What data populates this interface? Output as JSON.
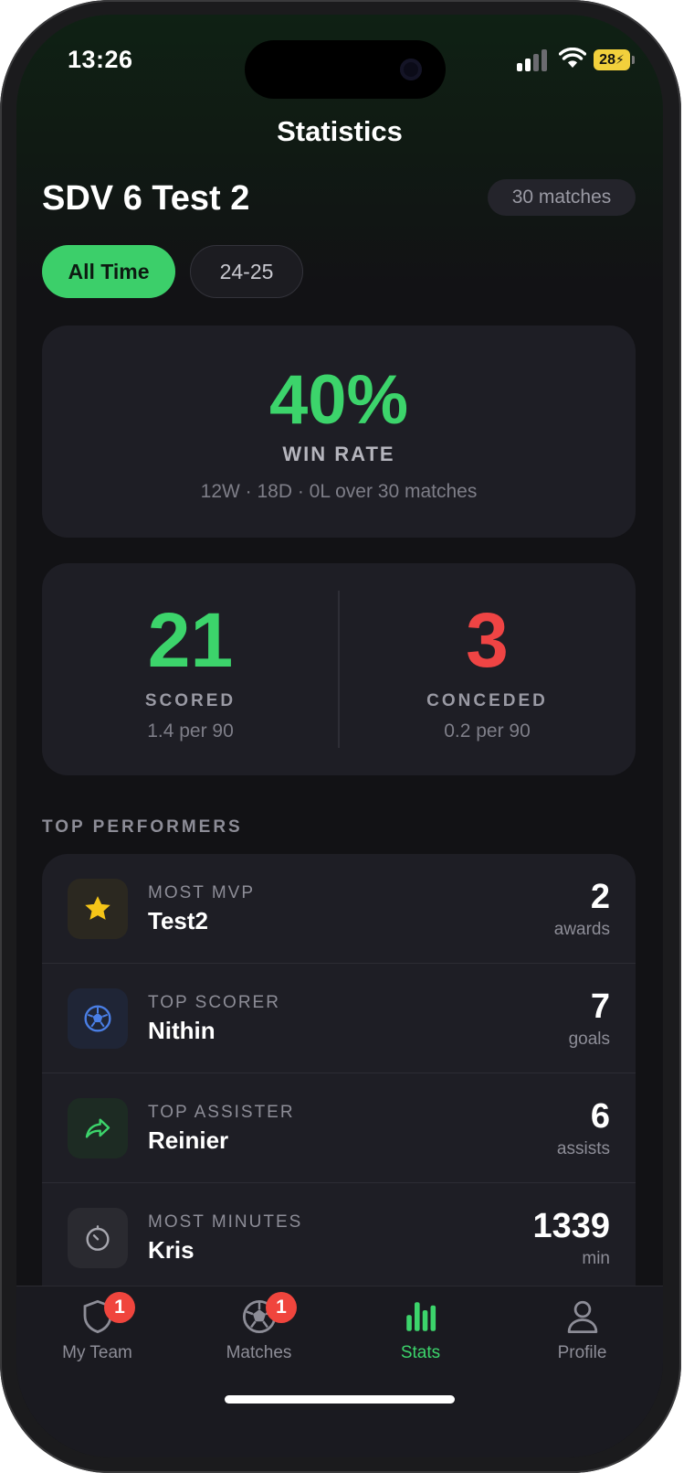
{
  "status_bar": {
    "time": "13:26",
    "battery": "28"
  },
  "nav": {
    "title": "Statistics"
  },
  "team": {
    "name": "SDV 6 Test 2",
    "matches_badge": "30 matches"
  },
  "filters": [
    {
      "label": "All Time",
      "selected": true
    },
    {
      "label": "24-25",
      "selected": false
    }
  ],
  "win_rate": {
    "value": "40%",
    "label": "WIN RATE",
    "detail": "12W · 18D · 0L over 30 matches"
  },
  "goals": {
    "scored": {
      "value": "21",
      "label": "SCORED",
      "rate": "1.4 per 90"
    },
    "conceded": {
      "value": "3",
      "label": "CONCEDED",
      "rate": "0.2 per 90"
    }
  },
  "top_performers": {
    "heading": "TOP PERFORMERS",
    "items": [
      {
        "category": "MOST MVP",
        "name": "Test2",
        "value": "2",
        "unit": "awards",
        "icon": "star-icon"
      },
      {
        "category": "TOP SCORER",
        "name": "Nithin",
        "value": "7",
        "unit": "goals",
        "icon": "soccer-ball-icon"
      },
      {
        "category": "TOP ASSISTER",
        "name": "Reinier",
        "value": "6",
        "unit": "assists",
        "icon": "share-arrow-icon"
      },
      {
        "category": "MOST MINUTES",
        "name": "Kris",
        "value": "1339",
        "unit": "min",
        "icon": "timer-icon"
      }
    ]
  },
  "tabs": [
    {
      "label": "My Team",
      "icon": "shield-icon",
      "badge": "1",
      "active": false
    },
    {
      "label": "Matches",
      "icon": "soccer-ball-icon",
      "badge": "1",
      "active": false
    },
    {
      "label": "Stats",
      "icon": "bar-chart-icon",
      "badge": "",
      "active": true
    },
    {
      "label": "Profile",
      "icon": "person-icon",
      "badge": "",
      "active": false
    }
  ],
  "colors": {
    "accent_green": "#3cd46b",
    "conceded_red": "#ef4444",
    "card_bg": "#1e1e25",
    "badge_red": "#f0453d",
    "star_yellow": "#f5c518",
    "scorer_blue": "#4a7fe6"
  }
}
